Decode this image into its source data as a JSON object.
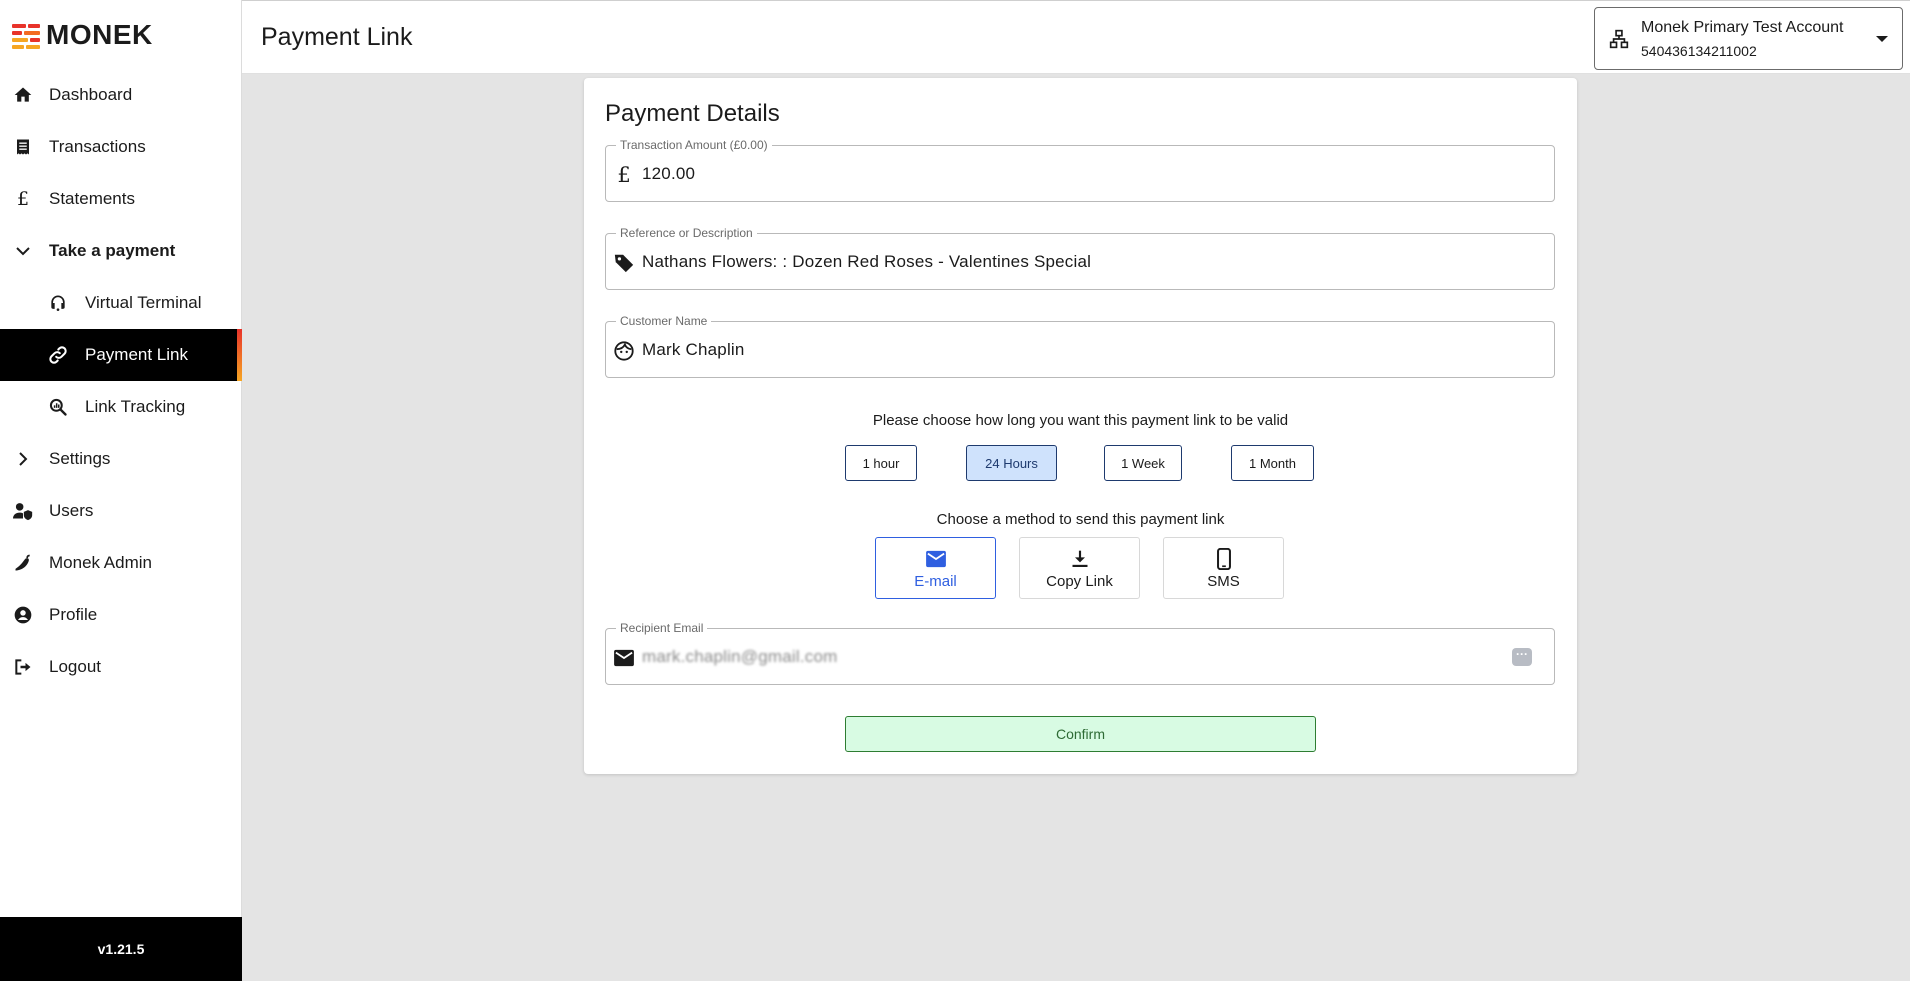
{
  "brand": {
    "name": "MONEK",
    "colors": {
      "red": "#e8332a",
      "orange": "#f6a623",
      "active": "#000000",
      "accent_blue": "#2f5fe0",
      "confirm_green": "#d8fbe3"
    }
  },
  "sidebar": {
    "items": [
      {
        "label": "Dashboard",
        "icon": "home-icon"
      },
      {
        "label": "Transactions",
        "icon": "receipt-icon"
      },
      {
        "label": "Statements",
        "icon": "pound-icon"
      },
      {
        "label": "Take a payment",
        "icon": "chevron-down-icon"
      },
      {
        "label": "Virtual Terminal",
        "icon": "headset-icon"
      },
      {
        "label": "Payment Link",
        "icon": "link-icon"
      },
      {
        "label": "Link Tracking",
        "icon": "search-chart-icon"
      },
      {
        "label": "Settings",
        "icon": "chevron-right-icon"
      },
      {
        "label": "Users",
        "icon": "user-shield-icon"
      },
      {
        "label": "Monek Admin",
        "icon": "pepper-icon"
      },
      {
        "label": "Profile",
        "icon": "account-circle-icon"
      },
      {
        "label": "Logout",
        "icon": "logout-icon"
      }
    ],
    "version": "v1.21.5"
  },
  "header": {
    "title": "Payment Link",
    "account": {
      "name": "Monek Primary Test Account",
      "number": "540436134211002",
      "icon": "sitemap-icon"
    }
  },
  "card": {
    "title": "Payment Details",
    "amount": {
      "label": "Transaction Amount (£0.00)",
      "value": "120.00",
      "icon": "pound-icon"
    },
    "reference": {
      "label": "Reference or Description",
      "value": "Nathans Flowers: : Dozen Red Roses - Valentines Special",
      "icon": "tag-icon"
    },
    "customer": {
      "label": "Customer Name",
      "value": "Mark Chaplin",
      "icon": "face-icon"
    },
    "validity_prompt": "Please choose how long you want this payment link to be valid",
    "durations": [
      "1 hour",
      "24 Hours",
      "1 Week",
      "1 Month"
    ],
    "selected_duration": "24 Hours",
    "method_prompt": "Choose a method to send this payment link",
    "methods": [
      {
        "label": "E-mail",
        "icon": "email-icon"
      },
      {
        "label": "Copy Link",
        "icon": "download-icon"
      },
      {
        "label": "SMS",
        "icon": "phone-icon"
      }
    ],
    "selected_method": "E-mail",
    "recipient": {
      "label": "Recipient Email",
      "value": "mark.chaplin@gmail.com",
      "icon": "email-icon"
    },
    "confirm_label": "Confirm"
  }
}
